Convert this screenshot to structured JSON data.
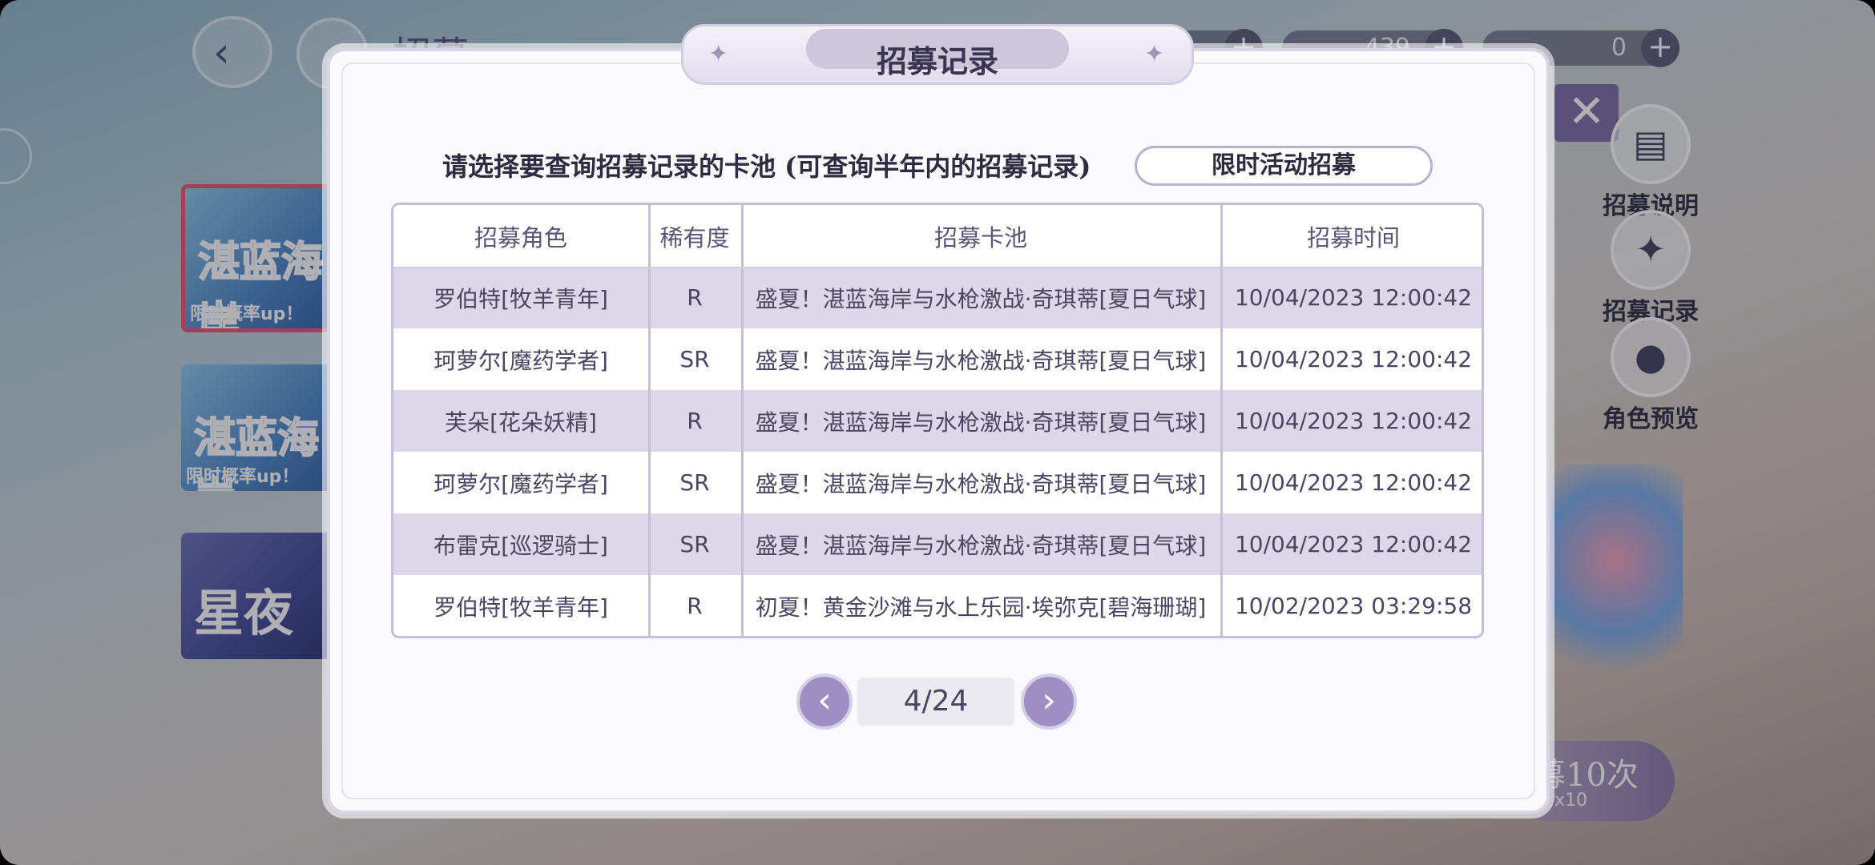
{
  "header": {
    "title": "招募",
    "resources": [
      {
        "value": "",
        "icon": "currency-icon"
      },
      {
        "value": "439",
        "icon": "gem-icon"
      },
      {
        "value": "0",
        "icon": "ticket-icon"
      }
    ]
  },
  "banners": [
    {
      "title": "湛蓝海岸",
      "tag": "限时概率up！"
    },
    {
      "title": "湛蓝海岸",
      "tag": "限时概率up！"
    },
    {
      "title": "星夜",
      "tag": ""
    }
  ],
  "side_menu": [
    {
      "label": "招募说明",
      "icon": "clipboard-icon"
    },
    {
      "label": "招募记录",
      "icon": "cards-icon"
    },
    {
      "label": "角色预览",
      "icon": "person-icon"
    }
  ],
  "recruit10": {
    "label": "募10次",
    "cost": "x10"
  },
  "dialog": {
    "title": "招募记录",
    "prompt": "请选择要查询招募记录的卡池 (可查询半年内的招募记录)",
    "pool_button": "限时活动招募",
    "columns": [
      "招募角色",
      "稀有度",
      "招募卡池",
      "招募时间"
    ],
    "rows": [
      [
        "罗伯特[牧羊青年]",
        "R",
        "盛夏！湛蓝海岸与水枪激战·奇琪蒂[夏日气球]",
        "10/04/2023 12:00:42"
      ],
      [
        "珂萝尔[魔药学者]",
        "SR",
        "盛夏！湛蓝海岸与水枪激战·奇琪蒂[夏日气球]",
        "10/04/2023 12:00:42"
      ],
      [
        "芙朵[花朵妖精]",
        "R",
        "盛夏！湛蓝海岸与水枪激战·奇琪蒂[夏日气球]",
        "10/04/2023 12:00:42"
      ],
      [
        "珂萝尔[魔药学者]",
        "SR",
        "盛夏！湛蓝海岸与水枪激战·奇琪蒂[夏日气球]",
        "10/04/2023 12:00:42"
      ],
      [
        "布雷克[巡逻骑士]",
        "SR",
        "盛夏！湛蓝海岸与水枪激战·奇琪蒂[夏日气球]",
        "10/04/2023 12:00:42"
      ],
      [
        "罗伯特[牧羊青年]",
        "R",
        "初夏！黄金沙滩与水上乐园·埃弥克[碧海珊瑚]",
        "10/02/2023 03:29:58"
      ]
    ],
    "pagination": {
      "page": "4/24"
    }
  }
}
